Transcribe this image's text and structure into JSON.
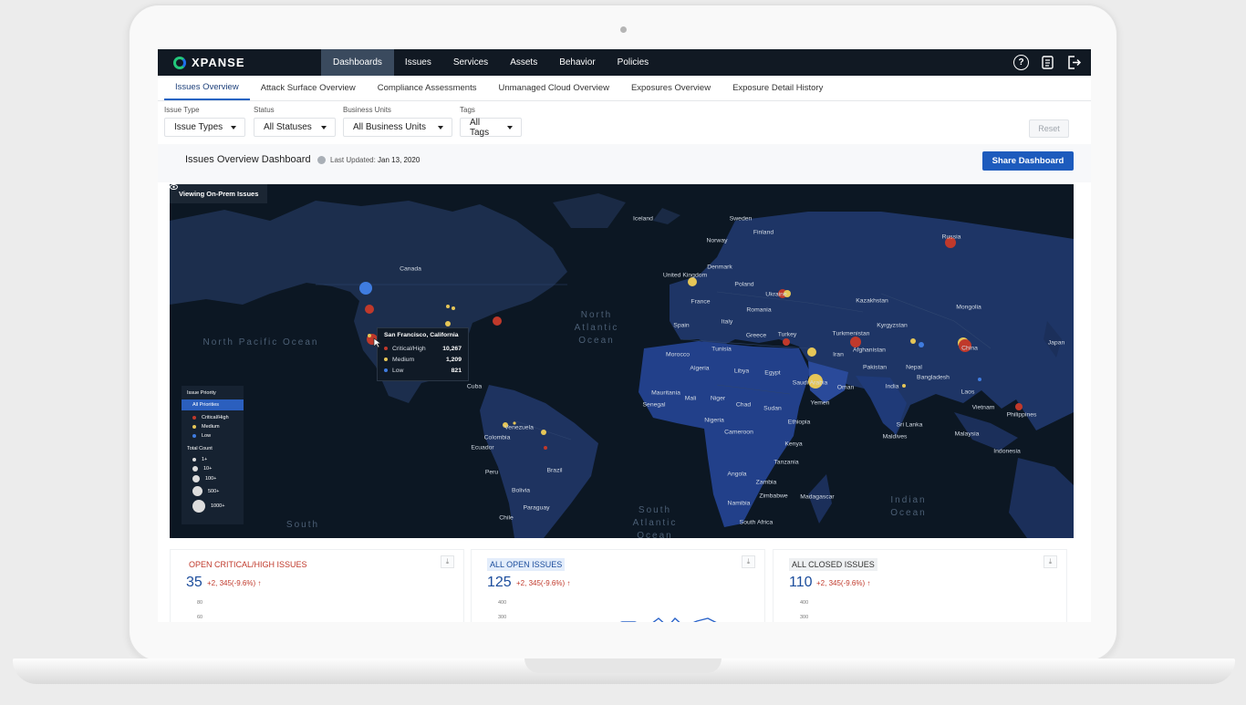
{
  "app": {
    "logo": "XPANSE"
  },
  "nav": {
    "items": [
      "Dashboards",
      "Issues",
      "Services",
      "Assets",
      "Behavior",
      "Policies"
    ],
    "active": "Dashboards"
  },
  "subtabs": [
    "Issues Overview",
    "Attack Surface Overview",
    "Compliance Assessments",
    "Unmanaged Cloud Overview",
    "Exposures Overview",
    "Exposure Detail History"
  ],
  "filters": [
    {
      "label": "Issue Type",
      "value": "Issue Types"
    },
    {
      "label": "Status",
      "value": "All Statuses"
    },
    {
      "label": "Business Units",
      "value": "All Business Units"
    },
    {
      "label": "Tags",
      "value": "All Tags"
    }
  ],
  "reset_label": "Reset",
  "dashboard": {
    "title": "Issues Overview Dashboard",
    "updated_label": "Last Updated:",
    "updated_value": "Jan 13, 2020",
    "share_label": "Share Dashboard"
  },
  "map": {
    "viewing_label": "Viewing On-Prem Issues",
    "oceans": {
      "north_pacific": "North Pacific Ocean",
      "north_atlantic": "North Atlantic Ocean",
      "south_pacific": "South",
      "south_atlantic": "South Atlantic Ocean",
      "indian": "Indian Ocean"
    },
    "labels": [
      "Iceland",
      "Sweden",
      "Finland",
      "Norway",
      "Russia",
      "Canada",
      "United Kingdom",
      "Denmark",
      "Poland",
      "Ukraine",
      "France",
      "Romania",
      "Kazakhstan",
      "Mongolia",
      "Kyrgyzstan",
      "Spain",
      "Italy",
      "Greece",
      "Turkey",
      "Turkmenistan",
      "Japan",
      "Morocco",
      "Tunisia",
      "Afghanistan",
      "China",
      "Iran",
      "Algeria",
      "Libya",
      "Egypt",
      "Pakistan",
      "Nepal",
      "Bangladesh",
      "Saudi Arabia",
      "Oman",
      "India",
      "Laos",
      "Mauritania",
      "Mali",
      "Niger",
      "Chad",
      "Sudan",
      "Yemen",
      "Vietnam",
      "Philippines",
      "Senegal",
      "Nigeria",
      "Ethiopia",
      "Sri Lanka",
      "Cameroon",
      "Maldives",
      "Malaysia",
      "Kenya",
      "Indonesia",
      "Cuba",
      "Venezuela",
      "Colombia",
      "Ecuador",
      "Tanzania",
      "Peru",
      "Brazil",
      "Angola",
      "Zambia",
      "Bolivia",
      "Zimbabwe",
      "Namibia",
      "Madagascar",
      "Paraguay",
      "South Africa",
      "Chile"
    ],
    "legend": {
      "priority_title": "Issue Priority",
      "priority_selected": "All Priorities",
      "priorities": [
        {
          "label": "Critical/High",
          "color": "#c0392b"
        },
        {
          "label": "Medium",
          "color": "#e6c657"
        },
        {
          "label": "Low",
          "color": "#3f7ce0"
        }
      ],
      "count_title": "Total Count",
      "counts": [
        "1+",
        "10+",
        "100+",
        "500+",
        "1000+"
      ]
    },
    "tooltip": {
      "title": "San Francisco, California",
      "rows": [
        {
          "label": "Critical/High",
          "value": "10,267",
          "color": "#c0392b"
        },
        {
          "label": "Medium",
          "value": "1,209",
          "color": "#e6c657"
        },
        {
          "label": "Low",
          "value": "821",
          "color": "#3f7ce0"
        }
      ]
    }
  },
  "cards": [
    {
      "title": "OPEN CRITICAL/HIGH ISSUES",
      "value": "35",
      "delta": "+2, 345(-9.6%)",
      "ticks": [
        "80",
        "60"
      ],
      "title_color": "#c0392b",
      "title_bg": "#ffffff"
    },
    {
      "title": "ALL OPEN ISSUES",
      "value": "125",
      "delta": "+2, 345(-9.6%)",
      "ticks": [
        "400",
        "300"
      ],
      "title_color": "#1c4d9c",
      "title_bg": "#e3edfb"
    },
    {
      "title": "ALL CLOSED ISSUES",
      "value": "110",
      "delta": "+2, 345(-9.6%)",
      "ticks": [
        "400",
        "300"
      ],
      "title_color": "#333333",
      "title_bg": "#eef0f2"
    }
  ]
}
